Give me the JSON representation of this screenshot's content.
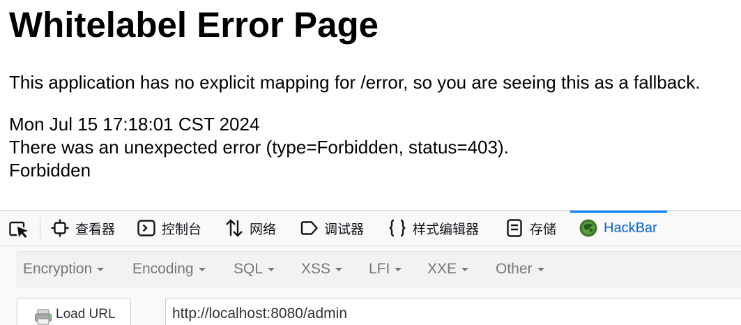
{
  "error_page": {
    "title": "Whitelabel Error Page",
    "description": "This application has no explicit mapping for /error, so you are seeing this as a fallback.",
    "timestamp": "Mon Jul 15 17:18:01 CST 2024",
    "error_message": "There was an unexpected error (type=Forbidden, status=403).",
    "reason": "Forbidden"
  },
  "devtools": {
    "tabs": [
      {
        "label": "查看器",
        "icon": "inspector-icon"
      },
      {
        "label": "控制台",
        "icon": "console-icon"
      },
      {
        "label": "网络",
        "icon": "network-icon"
      },
      {
        "label": "调试器",
        "icon": "debugger-icon"
      },
      {
        "label": "样式编辑器",
        "icon": "style-editor-icon"
      },
      {
        "label": "存储",
        "icon": "storage-icon"
      },
      {
        "label": "HackBar",
        "icon": "hackbar-icon",
        "active": true
      }
    ],
    "accent_color": "#0a84ff"
  },
  "hackbar": {
    "menu": [
      {
        "label": "Encryption"
      },
      {
        "label": "Encoding"
      },
      {
        "label": "SQL"
      },
      {
        "label": "XSS"
      },
      {
        "label": "LFI"
      },
      {
        "label": "XXE"
      },
      {
        "label": "Other"
      }
    ],
    "load_url_label": "Load URL",
    "url_value": "http://localhost:8080/admin"
  }
}
